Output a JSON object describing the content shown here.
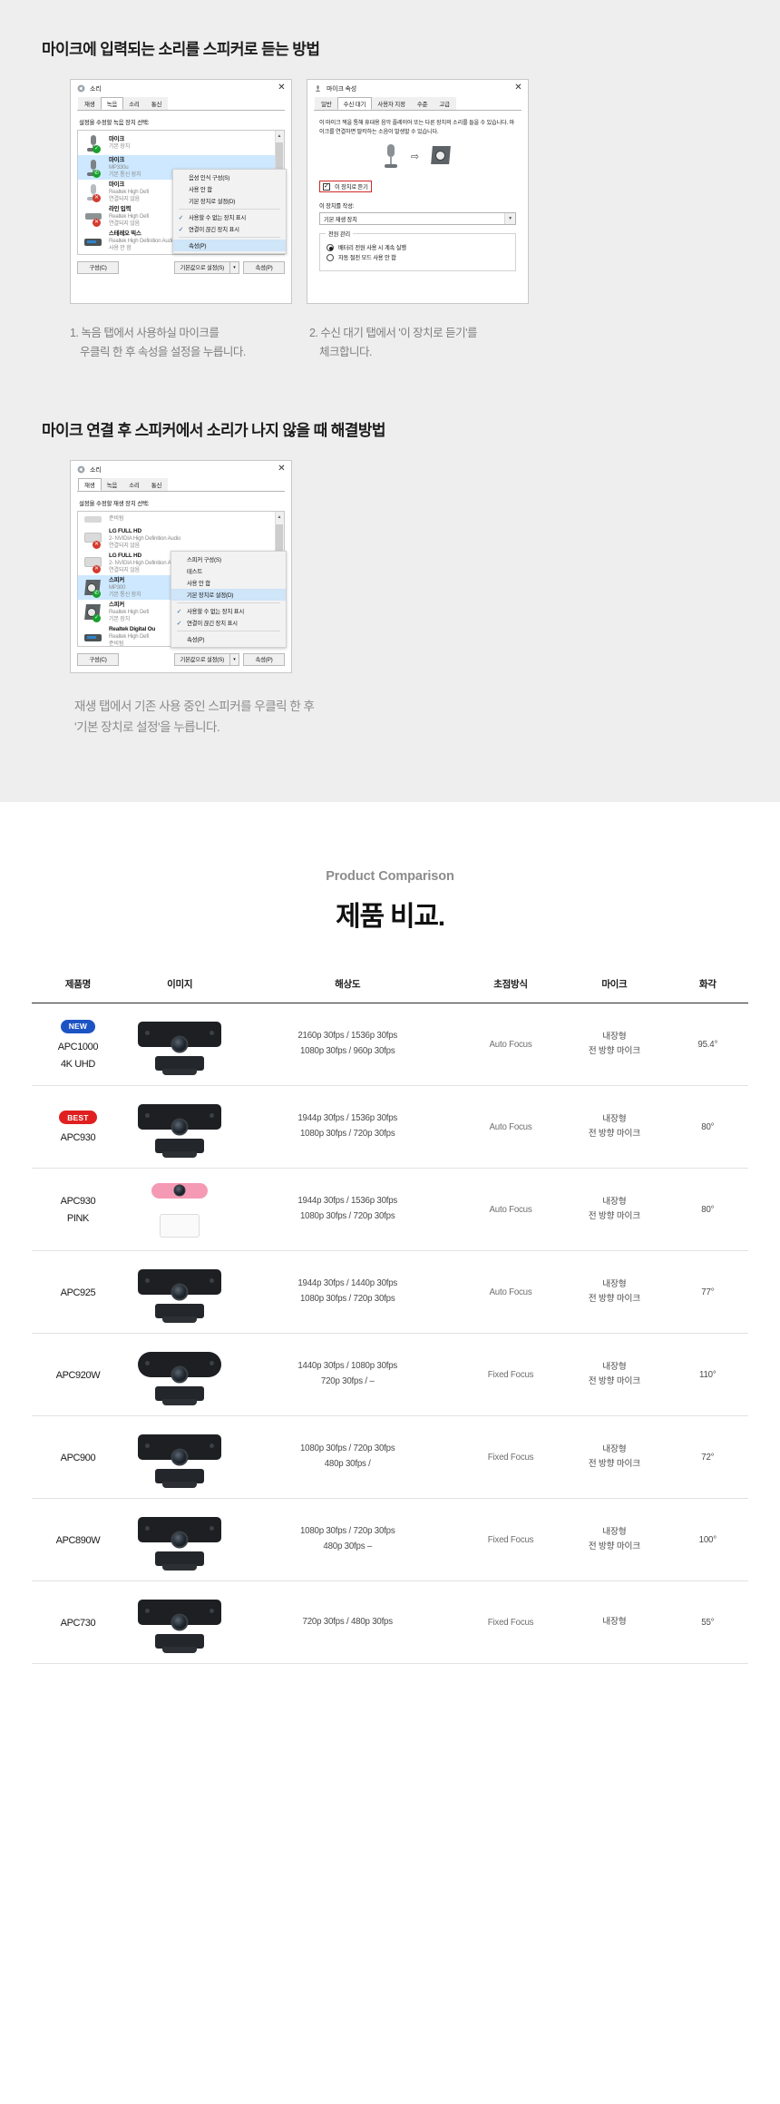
{
  "guide": {
    "section1_heading": "마이크에 입력되는 소리를 스피커로 듣는 방법",
    "section2_heading": "마이크 연결 후 스피커에서 소리가 나지 않을 때 해결방법",
    "caption1_line1": "1. 녹음 탭에서 사용하실 마이크를",
    "caption1_line2": "우클릭 한 후 속성을 설정을 누릅니다.",
    "caption2_line1": "2. 수신 대기 탭에서 '이 장치로 듣기'를",
    "caption2_line2": "체크합니다.",
    "caption3_line1": "재생 탭에서 기존 사용 중인 스피커를 우클릭 한 후",
    "caption3_line2": "'기본 장치로 설정'을 누릅니다."
  },
  "sound_dialog": {
    "title": "소리",
    "close": "✕",
    "tabs": [
      {
        "label": "재생",
        "selected": false
      },
      {
        "label": "녹음",
        "selected": true
      },
      {
        "label": "소리",
        "selected": false
      },
      {
        "label": "통신",
        "selected": false
      }
    ],
    "list_label": "설정을 수정할 녹음 장치 선택:",
    "devices": [
      {
        "name": "마이크",
        "sub": "",
        "status": "기본 장치",
        "icon": "microphone-icon",
        "badge": "green",
        "selected": false
      },
      {
        "name": "마이크",
        "sub": "MP330u",
        "status": "기본 통신 장치",
        "icon": "microphone-icon",
        "badge": "phone",
        "selected": true
      },
      {
        "name": "마이크",
        "sub": "Realtek High Defi",
        "status": "연결되지 않음",
        "icon": "microphone-icon",
        "badge": "red",
        "selected": false
      },
      {
        "name": "라인 입력",
        "sub": "Realtek High Defi",
        "status": "연결되지 않음",
        "icon": "line-in-icon",
        "badge": "red",
        "selected": false
      },
      {
        "name": "스테레오 믹스",
        "sub": "Realtek High Definition Audio",
        "status": "사용 안 함",
        "icon": "stereo-mix-icon",
        "badge": "none",
        "selected": false
      }
    ],
    "context_menu": [
      {
        "label": "음성 인식 구성(S)",
        "checked": false,
        "highlight": false
      },
      {
        "label": "사용 안 함",
        "checked": false,
        "highlight": false
      },
      {
        "label": "기본 장치로 설정(D)",
        "checked": false,
        "highlight": false
      },
      {
        "label": "사용할 수 없는 장치 표시",
        "checked": true,
        "highlight": false
      },
      {
        "label": "연결이 끊긴 장치 표시",
        "checked": true,
        "highlight": false
      },
      {
        "label": "속성(P)",
        "checked": false,
        "highlight": true
      }
    ],
    "buttons": {
      "configure": "구성(C)",
      "set_default": "기본값으로 설정(S)",
      "properties": "속성(P)",
      "caret": "▾"
    }
  },
  "mic_props_dialog": {
    "title": "마이크 속성",
    "close": "✕",
    "tabs": [
      {
        "label": "일반",
        "selected": false
      },
      {
        "label": "수신 대기",
        "selected": true
      },
      {
        "label": "사용자 지정",
        "selected": false
      },
      {
        "label": "수준",
        "selected": false
      },
      {
        "label": "고급",
        "selected": false
      }
    ],
    "description": "이 마이크 잭을 통해 휴대용 음악 플레이어 또는 다른 장치의 소리를 들을 수 있습니다. 마이크를 연결하면 딸칵하는 소음이 발생할 수 있습니다.",
    "listen_checkbox": {
      "label": "이 장치로 듣기",
      "checked": true
    },
    "playback_label": "이 장치를 작성:",
    "playback_select": "기본 재생 장치",
    "power_group": {
      "legend": "전원 관리",
      "options": [
        {
          "label": "배터리 전원 사용 시 계속 실행",
          "selected": true
        },
        {
          "label": "자동 절전 모드 사용 안 함",
          "selected": false
        }
      ]
    }
  },
  "playback_dialog": {
    "title": "소리",
    "close": "✕",
    "tabs": [
      {
        "label": "재생",
        "selected": true
      },
      {
        "label": "녹음",
        "selected": false
      },
      {
        "label": "소리",
        "selected": false
      },
      {
        "label": "통신",
        "selected": false
      }
    ],
    "list_label": "설정을 수정할 재생 장치 선택:",
    "devices": [
      {
        "name": "",
        "sub": "",
        "status": "준비됨",
        "icon": "monitor-icon",
        "badge": "none",
        "selected": false
      },
      {
        "name": "LG FULL HD",
        "sub": "2- NVIDIA High Definition Audio",
        "status": "연결되지 않음",
        "icon": "monitor-icon",
        "badge": "red",
        "selected": false
      },
      {
        "name": "LG FULL HD",
        "sub": "2- NVIDIA High Definition Audio",
        "status": "연결되지 않음",
        "icon": "monitor-icon",
        "badge": "red",
        "selected": false
      },
      {
        "name": "스피커",
        "sub": "MP300",
        "status": "기본 통신 장치",
        "icon": "speaker-icon",
        "badge": "phone",
        "selected": true
      },
      {
        "name": "스피커",
        "sub": "Realtek High Defi",
        "status": "기본 장치",
        "icon": "speaker-icon",
        "badge": "green",
        "selected": false
      },
      {
        "name": "Realtek Digital Ou",
        "sub": "Realtek High Defi",
        "status": "준비됨",
        "icon": "digital-out-icon",
        "badge": "none",
        "selected": false
      }
    ],
    "context_menu": [
      {
        "label": "스피커 구성(S)",
        "checked": false,
        "highlight": false
      },
      {
        "label": "테스트",
        "checked": false,
        "highlight": false
      },
      {
        "label": "사용 안 함",
        "checked": false,
        "highlight": false
      },
      {
        "label": "기본 장치로 설정(D)",
        "checked": false,
        "highlight": true
      },
      {
        "label": "사용할 수 없는 장치 표시",
        "checked": true,
        "highlight": false
      },
      {
        "label": "연결이 끊긴 장치 표시",
        "checked": true,
        "highlight": false
      },
      {
        "label": "속성(P)",
        "checked": false,
        "highlight": false
      }
    ],
    "buttons": {
      "configure": "구성(C)",
      "set_default": "기본값으로 설정(S)",
      "properties": "속성(P)",
      "caret": "▾"
    }
  },
  "comparison": {
    "supertitle": "Product Comparison",
    "title": "제품 비교.",
    "headers": [
      "제품명",
      "이미지",
      "해상도",
      "초점방식",
      "마이크",
      "화각"
    ],
    "rows": [
      {
        "tag": "NEW",
        "tag_type": "new",
        "name_line1": "APC1000",
        "name_line2": "4K UHD",
        "cam_style": "black-wide",
        "res_line1": "2160p 30fps / 1536p 30fps",
        "res_line2": "1080p 30fps / 960p 30fps",
        "focus": "Auto Focus",
        "mic_line1": "내장형",
        "mic_line2": "전 방향 마이크",
        "angle": "95.4°"
      },
      {
        "tag": "BEST",
        "tag_type": "best",
        "name_line1": "APC930",
        "name_line2": "",
        "cam_style": "black-wide",
        "res_line1": "1944p 30fps / 1536p 30fps",
        "res_line2": "1080p 30fps / 720p 30fps",
        "focus": "Auto Focus",
        "mic_line1": "내장형",
        "mic_line2": "전 방향 마이크",
        "angle": "80°"
      },
      {
        "tag": "",
        "tag_type": "",
        "name_line1": "APC930",
        "name_line2": "PINK",
        "cam_style": "pink",
        "res_line1": "1944p 30fps / 1536p 30fps",
        "res_line2": "1080p 30fps / 720p 30fps",
        "focus": "Auto Focus",
        "mic_line1": "내장형",
        "mic_line2": "전 방향 마이크",
        "angle": "80°"
      },
      {
        "tag": "",
        "tag_type": "",
        "name_line1": "APC925",
        "name_line2": "",
        "cam_style": "black-wide",
        "res_line1": "1944p 30fps / 1440p 30fps",
        "res_line2": "1080p 30fps / 720p 30fps",
        "focus": "Auto Focus",
        "mic_line1": "내장형",
        "mic_line2": "전 방향 마이크",
        "angle": "77°"
      },
      {
        "tag": "",
        "tag_type": "",
        "name_line1": "APC920W",
        "name_line2": "",
        "cam_style": "black-round",
        "res_line1": "1440p 30fps / 1080p 30fps",
        "res_line2": "720p 30fps /    –",
        "focus": "Fixed Focus",
        "mic_line1": "내장형",
        "mic_line2": "전 방향 마이크",
        "angle": "110°"
      },
      {
        "tag": "",
        "tag_type": "",
        "name_line1": "APC900",
        "name_line2": "",
        "cam_style": "black-wide",
        "res_line1": "1080p 30fps / 720p 30fps",
        "res_line2": "480p 30fps /",
        "focus": "Fixed Focus",
        "mic_line1": "내장형",
        "mic_line2": "전 방향 마이크",
        "angle": "72°"
      },
      {
        "tag": "",
        "tag_type": "",
        "name_line1": "APC890W",
        "name_line2": "",
        "cam_style": "black-wide",
        "res_line1": "1080p 30fps / 720p 30fps",
        "res_line2": "480p 30fps      –",
        "focus": "Fixed Focus",
        "mic_line1": "내장형",
        "mic_line2": "전 방향 마이크",
        "angle": "100°"
      },
      {
        "tag": "",
        "tag_type": "",
        "name_line1": "APC730",
        "name_line2": "",
        "cam_style": "black-wide",
        "res_line1": "720p 30fps / 480p 30fps",
        "res_line2": "",
        "focus": "Fixed Focus",
        "mic_line1": "내장형",
        "mic_line2": "",
        "angle": "55°"
      }
    ]
  }
}
